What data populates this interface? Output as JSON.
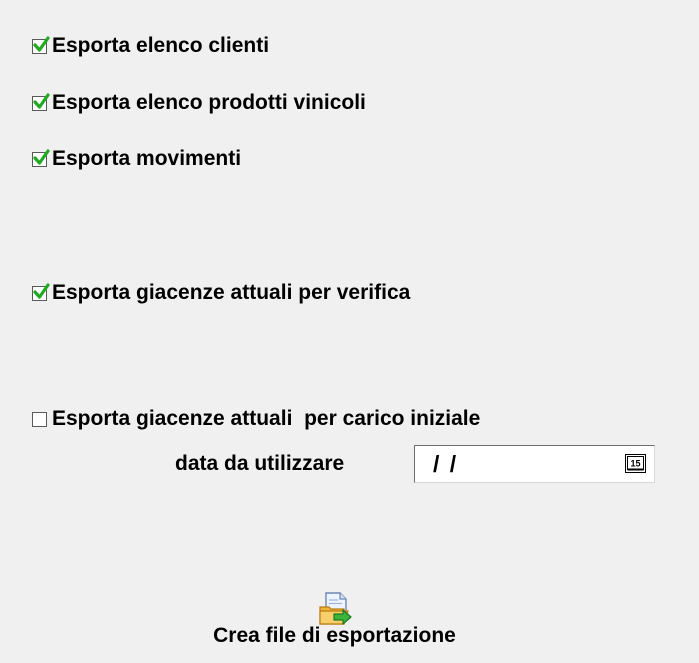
{
  "options": [
    {
      "label": "Esporta elenco clienti",
      "checked": true
    },
    {
      "label": "Esporta elenco prodotti vinicoli",
      "checked": true
    },
    {
      "label": "Esporta movimenti",
      "checked": true
    },
    {
      "label": "Esporta giacenze attuali per verifica",
      "checked": true
    },
    {
      "label": "Esporta giacenze attuali  per carico iniziale",
      "checked": false
    }
  ],
  "date": {
    "label": "data da utilizzare",
    "value": "/ /",
    "calendar_icon_text": "15"
  },
  "export_button": {
    "label": "Crea file di esportazione",
    "icon": "export-file-icon"
  },
  "colors": {
    "background": "#f0f0f0",
    "check_mark": "#1faa1f"
  }
}
